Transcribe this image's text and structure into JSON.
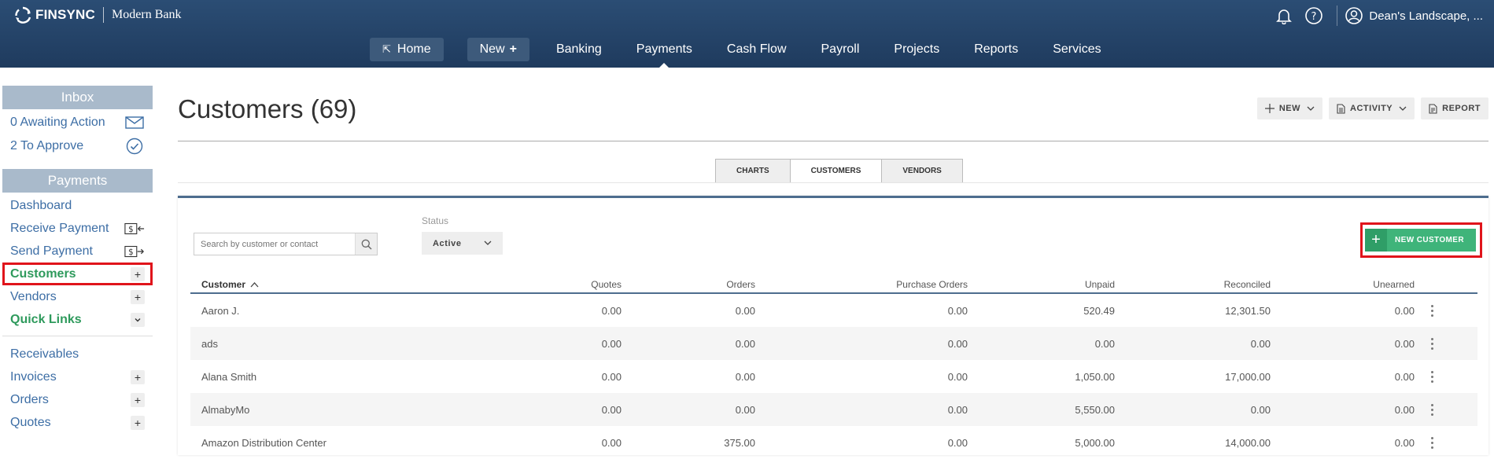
{
  "brand": {
    "logo": "FINSYNC",
    "bank": "Modern Bank"
  },
  "header": {
    "account": "Dean's Landscape, ...",
    "icons": [
      "bell-icon",
      "help-icon",
      "user-circle-icon"
    ]
  },
  "nav": {
    "home": "Home",
    "new": "New",
    "items": [
      "Banking",
      "Payments",
      "Cash Flow",
      "Payroll",
      "Projects",
      "Reports",
      "Services"
    ],
    "active": "Payments"
  },
  "sidebar": {
    "inbox": {
      "title": "Inbox",
      "items": [
        {
          "label": "0 Awaiting Action",
          "icon": "envelope-icon"
        },
        {
          "label": "2 To Approve",
          "icon": "check-circle-icon"
        }
      ]
    },
    "payments": {
      "title": "Payments",
      "dashboard": "Dashboard",
      "receive": "Receive Payment",
      "send": "Send Payment",
      "customers": "Customers",
      "vendors": "Vendors",
      "quick_links": "Quick Links",
      "receivables": "Receivables",
      "invoices": "Invoices",
      "orders": "Orders",
      "quotes": "Quotes"
    }
  },
  "page": {
    "title": "Customers (69)",
    "actions": {
      "new": "NEW",
      "activity": "ACTIVITY",
      "report": "REPORT"
    },
    "tabs": [
      "CHARTS",
      "CUSTOMERS",
      "VENDORS"
    ],
    "active_tab": "CUSTOMERS"
  },
  "filters": {
    "search_placeholder": "Search by customer or contact",
    "status_label": "Status",
    "status_value": "Active",
    "new_customer": "NEW CUSTOMER"
  },
  "table": {
    "columns": {
      "customer": "Customer",
      "quotes": "Quotes",
      "orders": "Orders",
      "purchase_orders": "Purchase Orders",
      "unpaid": "Unpaid",
      "reconciled": "Reconciled",
      "unearned": "Unearned"
    },
    "rows": [
      {
        "customer": "Aaron J.",
        "quotes": "0.00",
        "orders": "0.00",
        "purchase_orders": "0.00",
        "unpaid": "520.49",
        "reconciled": "12,301.50",
        "unearned": "0.00"
      },
      {
        "customer": "ads",
        "quotes": "0.00",
        "orders": "0.00",
        "purchase_orders": "0.00",
        "unpaid": "0.00",
        "reconciled": "0.00",
        "unearned": "0.00"
      },
      {
        "customer": "Alana Smith",
        "quotes": "0.00",
        "orders": "0.00",
        "purchase_orders": "0.00",
        "unpaid": "1,050.00",
        "reconciled": "17,000.00",
        "unearned": "0.00"
      },
      {
        "customer": "AlmabyMo",
        "quotes": "0.00",
        "orders": "0.00",
        "purchase_orders": "0.00",
        "unpaid": "5,550.00",
        "reconciled": "0.00",
        "unearned": "0.00"
      },
      {
        "customer": "Amazon Distribution Center",
        "quotes": "0.00",
        "orders": "375.00",
        "purchase_orders": "0.00",
        "unpaid": "5,000.00",
        "reconciled": "14,000.00",
        "unearned": "0.00"
      }
    ]
  },
  "colors": {
    "header": "#1f3b5e",
    "accent_green": "#3fb47a",
    "highlight_red": "#e0141b",
    "sidebar_head": "#a9bacb"
  }
}
